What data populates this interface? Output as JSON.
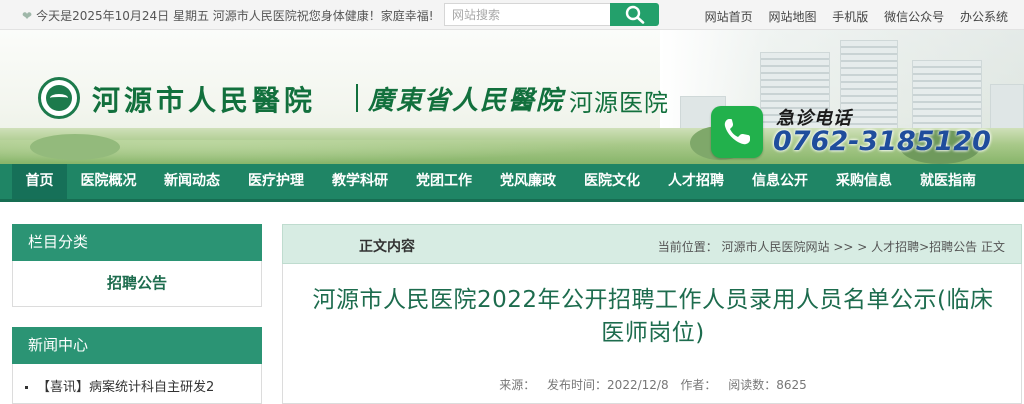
{
  "topbar": {
    "greeting": "今天是2025年10月24日 星期五  河源市人民医院祝您身体健康！家庭幸福!",
    "search_placeholder": "网站搜索",
    "links": [
      "网站首页",
      "网站地图",
      "手机版",
      "微信公众号",
      "办公系统"
    ]
  },
  "banner": {
    "name_primary": "河源市人民醫院",
    "name_secondary": "廣東省人民醫院",
    "name_secondary_suffix": "河源医院",
    "emergency_label": "急诊电话",
    "emergency_number": "0762-3185120"
  },
  "nav": {
    "items": [
      "首页",
      "医院概况",
      "新闻动态",
      "医疗护理",
      "教学科研",
      "党团工作",
      "党风廉政",
      "医院文化",
      "人才招聘",
      "信息公开",
      "采购信息",
      "就医指南"
    ]
  },
  "sidebar": {
    "category_heading": "栏目分类",
    "category_item": "招聘公告",
    "news_heading": "新闻中心",
    "news_items": [
      "【喜讯】病案统计科自主研发2"
    ]
  },
  "main": {
    "section_title": "正文内容",
    "breadcrumb": "当前位置：  河源市人民医院网站  >> > 人才招聘>招聘公告  正文",
    "article_title": "河源市人民医院2022年公开招聘工作人员录用人员名单公示(临床医师岗位)",
    "meta": {
      "source": "来源：",
      "date": "发布时间：2022/12/8",
      "author": "作者：",
      "views": "阅读数：8625"
    }
  },
  "colors": {
    "brand_green": "#1f8565",
    "accent_green": "#23a06b",
    "title_green": "#1d6c4e",
    "phone_blue": "#1f4d9c"
  }
}
